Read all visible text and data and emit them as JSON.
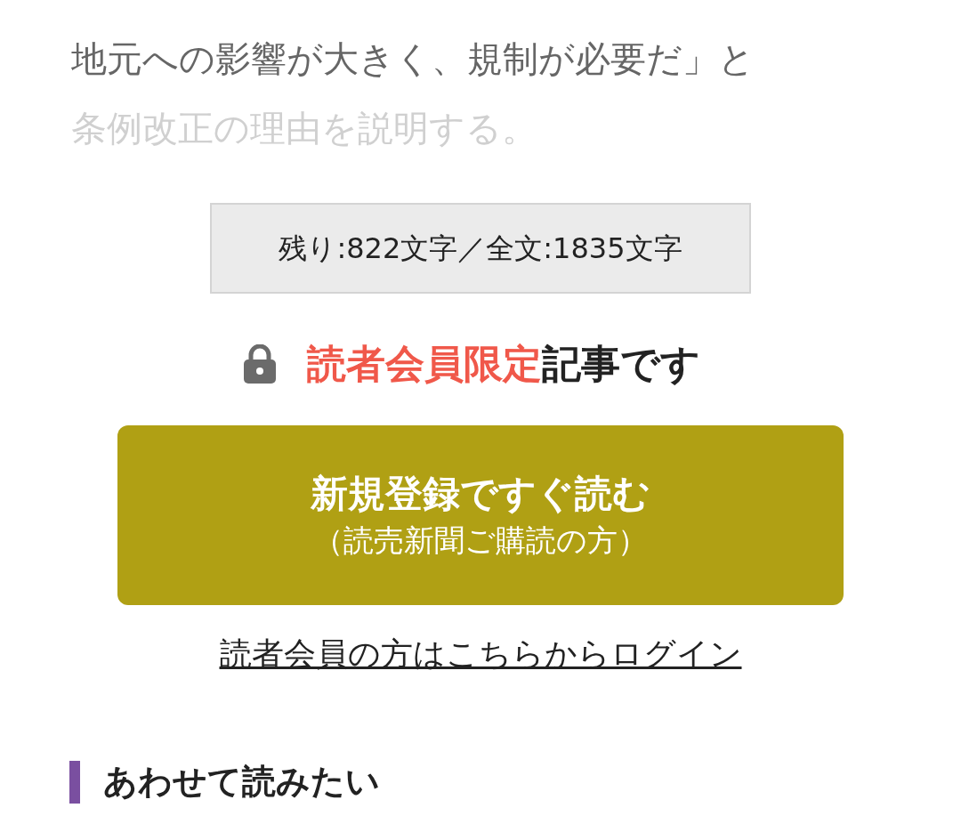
{
  "article": {
    "lines": [
      {
        "text": "地元への影響が大きく、規制が必要だ」と",
        "faded": false
      },
      {
        "text": "条例改正の理由を説明する。",
        "faded": true
      }
    ]
  },
  "counter": "残り:822文字／全文:1835文字",
  "notice": {
    "parts": [
      {
        "text": "読者会員限定",
        "kind": "highlight"
      },
      {
        "text": "記事です",
        "kind": "plain"
      }
    ]
  },
  "register_button": {
    "title": "新規登録ですぐ読む",
    "subtitle": "（読売新聞ご購読の方）"
  },
  "login_link": "読者会員の方はこちらからログイン",
  "related_heading": "あわせて読みたい"
}
